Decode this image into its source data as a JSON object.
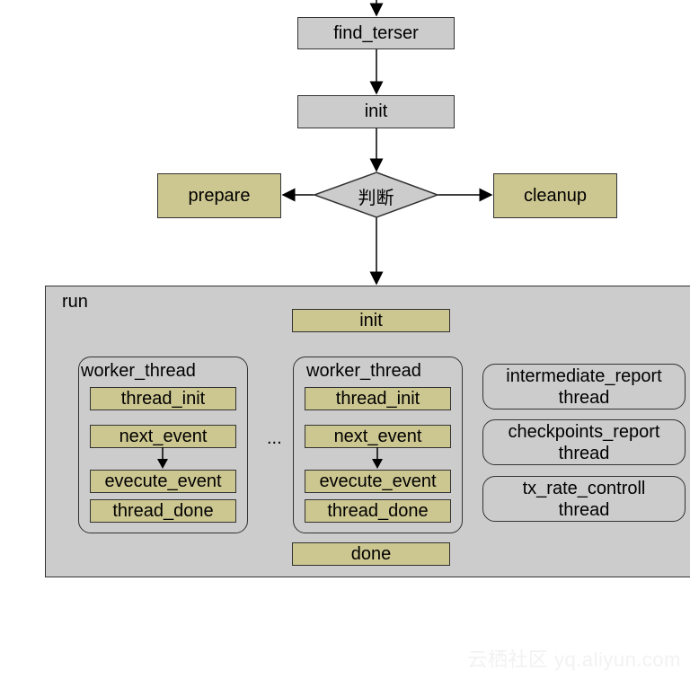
{
  "flow": {
    "find_terser": "find_terser",
    "init": "init",
    "decision": "判断",
    "prepare": "prepare",
    "cleanup": "cleanup"
  },
  "run": {
    "title": "run",
    "init": "init",
    "done": "done",
    "ellipsis": "...",
    "workers": [
      {
        "title": "worker_thread",
        "steps": [
          "thread_init",
          "next_event",
          "evecute_event",
          "thread_done"
        ]
      },
      {
        "title": "worker_thread",
        "steps": [
          "thread_init",
          "next_event",
          "evecute_event",
          "thread_done"
        ]
      }
    ],
    "side_threads": [
      {
        "line1": "intermediate_report",
        "line2": "thread"
      },
      {
        "line1": "checkpoints_report",
        "line2": "thread"
      },
      {
        "line1": "tx_rate_controll",
        "line2": "thread"
      }
    ]
  },
  "colors": {
    "gray_box": "#cccccc",
    "olive_box": "#ccc690",
    "border": "#333333"
  },
  "watermark": "云栖社区 yq.aliyun.com"
}
